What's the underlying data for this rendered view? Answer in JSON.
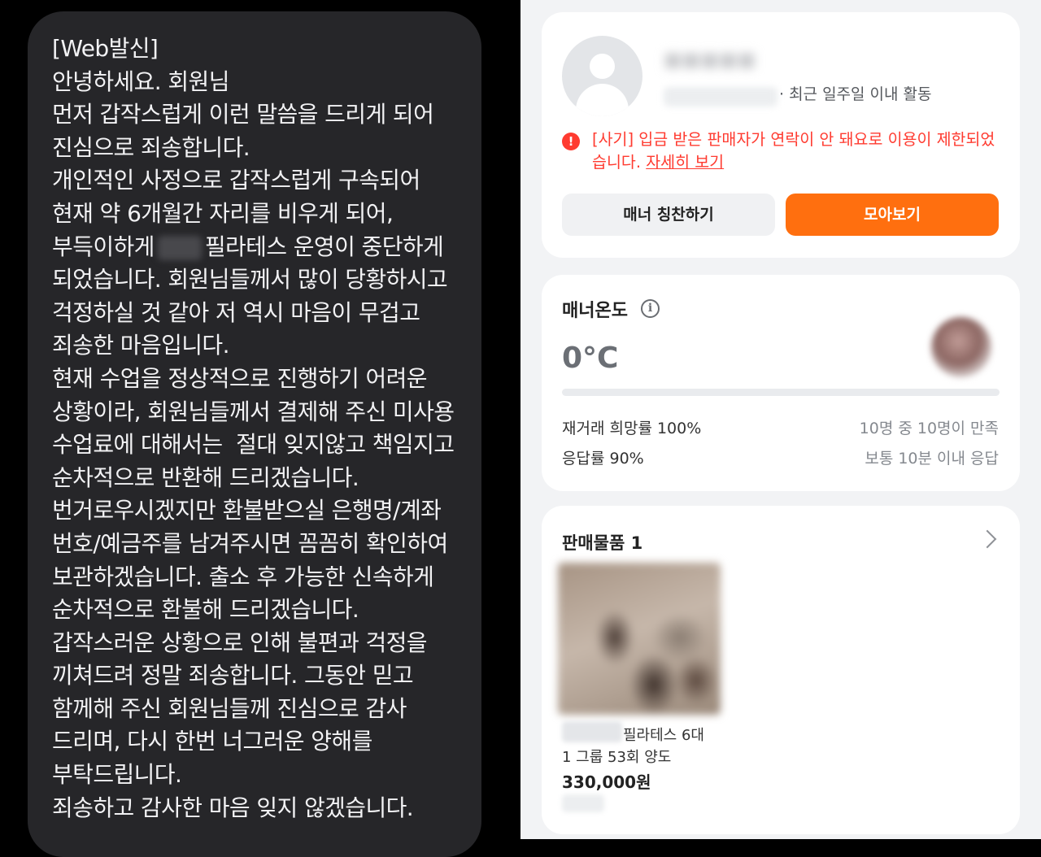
{
  "sms": {
    "lines": [
      "[Web발신]",
      "안녕하세요. 회원님",
      "먼저 갑작스럽게 이런 말씀을 드리게 되어",
      "진심으로 죄송합니다.",
      "개인적인 사정으로 갑작스럽게 구속되어",
      "현재 약 6개월간 자리를 비우게 되어,",
      "필라테스 운영이 중단하게",
      "되었습니다. 회원님들께서 많이 당황하시고",
      "걱정하실 것 같아 저 역시 마음이 무겁고",
      "죄송한 마음입니다.",
      "현재 수업을 정상적으로 진행하기 어려운",
      "상황이라, 회원님들께서 결제해 주신 미사용",
      "수업료에 대해서는  절대 잊지않고 책임지고",
      "순차적으로 반환해 드리겠습니다.",
      "번거로우시겠지만 환불받으실 은행명/계좌",
      "번호/예금주를 남겨주시면 꼼꼼히 확인하여",
      "보관하겠습니다. 출소 후 가능한 신속하게",
      "순차적으로 환불해 드리겠습니다.",
      "갑작스러운 상황으로 인해 불편과 걱정을",
      "끼쳐드려 정말 죄송합니다. 그동안 믿고",
      "함께해 주신 회원님들께 진심으로 감사",
      "드리며, 다시 한번 너그러운 양해를",
      "부탁드립니다.",
      "죄송하고 감사한 마음 잊지 않겠습니다."
    ],
    "line7_prefix": "부득이하게"
  },
  "profile": {
    "activity": "· 최근 일주일 이내 활동",
    "warning_icon": "exclamation-circle-icon",
    "warning_text": "[사기] 입금 받은 판매자가 연락이 안 돼요로 이용이 제한되었습니다. ",
    "warning_link": "자세히 보기",
    "btn_praise": "매너 칭찬하기",
    "btn_collect": "모아보기",
    "accent_color": "#ff6f0f",
    "warning_color": "#ff3b30"
  },
  "manner": {
    "title": "매너온도",
    "temperature": "0°C",
    "temperature_level": 0,
    "rebuy_label": "재거래 희망률 100%",
    "rebuy_detail": "10명 중 10명이 만족",
    "response_label": "응답률 90%",
    "response_detail": "보통 10분 이내 응답"
  },
  "sales": {
    "title": "판매물품 1",
    "item_line1": "필라테스 6대",
    "item_line2": "1 그룹 53회 양도",
    "item_price": "330,000원"
  }
}
